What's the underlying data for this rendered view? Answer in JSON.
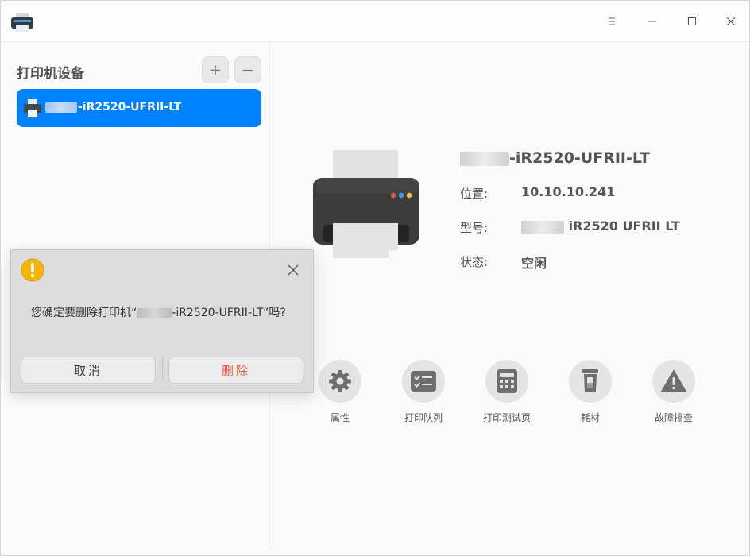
{
  "sidebar": {
    "title": "打印机设备",
    "add_label": "+",
    "remove_label": "−",
    "printers": [
      {
        "name_suffix": "-iR2520-UFRII-LT"
      }
    ]
  },
  "details": {
    "name_suffix": "-iR2520-UFRII-LT",
    "location_label": "位置:",
    "location_value": "10.10.10.241",
    "model_label": "型号:",
    "model_value_suffix": "iR2520 UFRII LT",
    "status_label": "状态:",
    "status_value": "空闲"
  },
  "actions": [
    {
      "label": "属性",
      "icon": "gear-icon"
    },
    {
      "label": "打印队列",
      "icon": "queue-list-icon"
    },
    {
      "label": "打印测试页",
      "icon": "calculator-test-page-icon"
    },
    {
      "label": "耗材",
      "icon": "ink-cartridge-icon"
    },
    {
      "label": "故障排查",
      "icon": "warning-triangle-icon"
    }
  ],
  "dialog": {
    "message_prefix": "您确定要删除打印机“",
    "message_suffix": "-iR2520-UFRII-LT”吗?",
    "cancel_label": "取消",
    "delete_label": "删除"
  },
  "colors": {
    "accent": "#0081ff",
    "danger": "#ff5736",
    "warning": "#f7b500"
  }
}
